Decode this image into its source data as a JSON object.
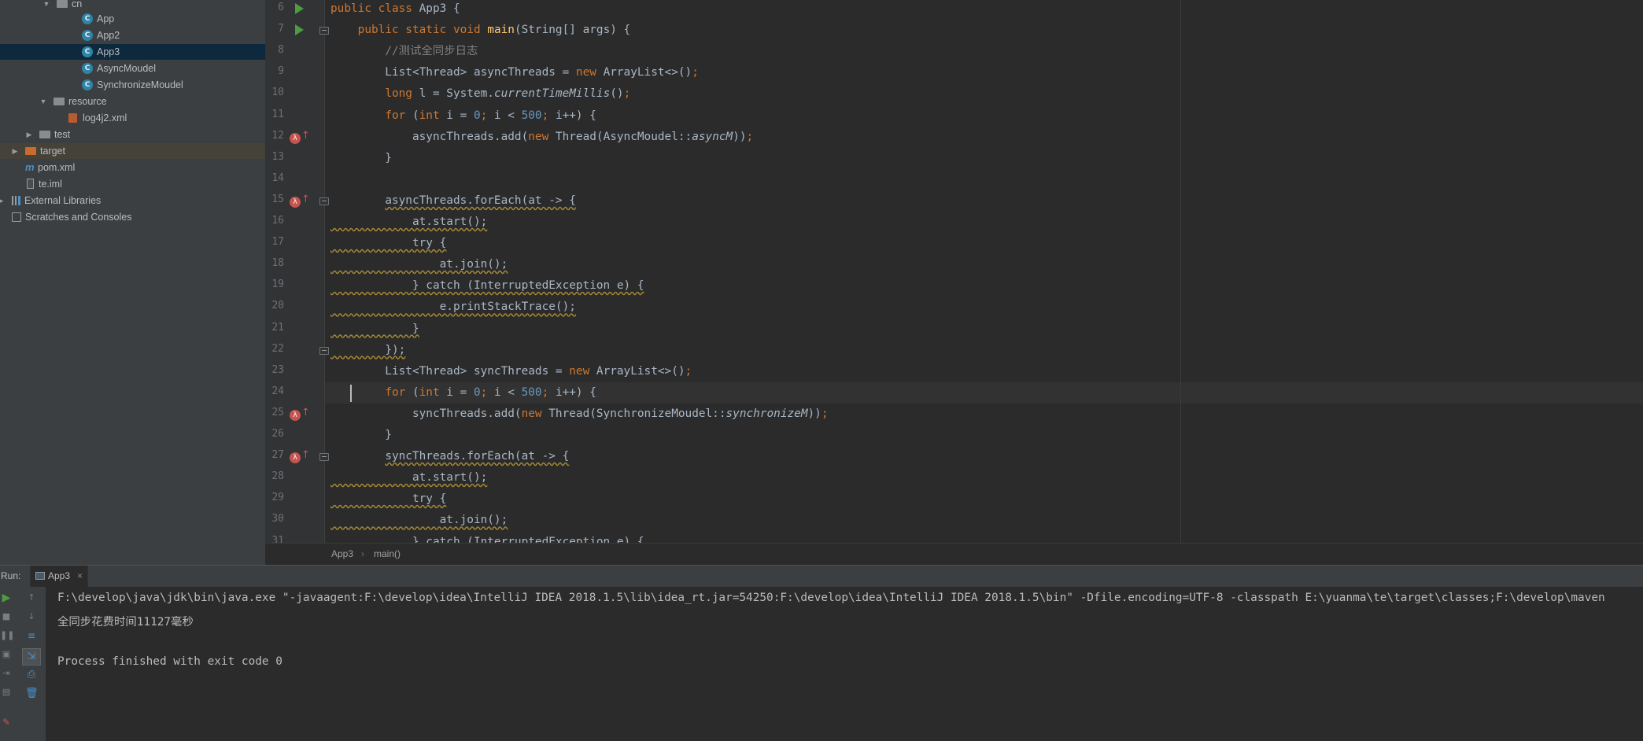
{
  "project_tree": {
    "items": [
      {
        "label": "cn",
        "kind": "package"
      },
      {
        "label": "App",
        "kind": "class"
      },
      {
        "label": "App2",
        "kind": "class"
      },
      {
        "label": "App3",
        "kind": "class",
        "selected": true
      },
      {
        "label": "AsyncMoudel",
        "kind": "class"
      },
      {
        "label": "SynchronizeMoudel",
        "kind": "class"
      },
      {
        "label": "resource",
        "kind": "folder"
      },
      {
        "label": "log4j2.xml",
        "kind": "xml"
      },
      {
        "label": "test",
        "kind": "folder"
      },
      {
        "label": "target",
        "kind": "folder-target"
      },
      {
        "label": "pom.xml",
        "kind": "maven"
      },
      {
        "label": "te.iml",
        "kind": "file"
      },
      {
        "label": "External Libraries",
        "kind": "library"
      },
      {
        "label": "Scratches and Consoles",
        "kind": "scratch"
      }
    ],
    "class_icon_letter": "C"
  },
  "editor": {
    "lines": [
      {
        "n": "6",
        "code": [
          [
            "k",
            "public class "
          ],
          [
            "p",
            "App3 {"
          ]
        ]
      },
      {
        "n": "7",
        "code": [
          [
            "p",
            "    "
          ],
          [
            "k",
            "public static void "
          ],
          [
            "f",
            "main"
          ],
          [
            "p",
            "(String[] args) {"
          ]
        ]
      },
      {
        "n": "8",
        "code": [
          [
            "p",
            "        "
          ],
          [
            "c",
            "//测试全同步日志"
          ]
        ]
      },
      {
        "n": "9",
        "code": [
          [
            "p",
            "        List<Thread> asyncThreads = "
          ],
          [
            "k",
            "new "
          ],
          [
            "p",
            "ArrayList<>()"
          ],
          [
            "k",
            ";"
          ]
        ]
      },
      {
        "n": "10",
        "code": [
          [
            "p",
            "        "
          ],
          [
            "k",
            "long "
          ],
          [
            "p",
            "l = System."
          ],
          [
            "i",
            "currentTimeMillis"
          ],
          [
            "p",
            "()"
          ],
          [
            "k",
            ";"
          ]
        ]
      },
      {
        "n": "11",
        "code": [
          [
            "p",
            "        "
          ],
          [
            "k",
            "for "
          ],
          [
            "p",
            "("
          ],
          [
            "k",
            "int "
          ],
          [
            "p",
            "i = "
          ],
          [
            "n",
            "0"
          ],
          [
            "k",
            "; "
          ],
          [
            "p",
            "i < "
          ],
          [
            "n",
            "500"
          ],
          [
            "k",
            "; "
          ],
          [
            "p",
            "i++) {"
          ]
        ]
      },
      {
        "n": "12",
        "code": [
          [
            "p",
            "            asyncThreads.add("
          ],
          [
            "k",
            "new "
          ],
          [
            "p",
            "Thread(AsyncMoudel::"
          ],
          [
            "i",
            "asyncM"
          ],
          [
            "p",
            "))"
          ],
          [
            "k",
            ";"
          ]
        ]
      },
      {
        "n": "13",
        "code": [
          [
            "p",
            "        }"
          ]
        ]
      },
      {
        "n": "14",
        "code": []
      },
      {
        "n": "15",
        "code": [
          [
            "p",
            "        "
          ],
          [
            "w",
            "asyncThreads.forEach(at -> {"
          ]
        ]
      },
      {
        "n": "16",
        "code": [
          [
            "w",
            "            at.start();"
          ]
        ]
      },
      {
        "n": "17",
        "code": [
          [
            "w",
            "            try {"
          ]
        ]
      },
      {
        "n": "18",
        "code": [
          [
            "w",
            "                at.join();"
          ]
        ]
      },
      {
        "n": "19",
        "code": [
          [
            "w",
            "            } catch (InterruptedException e) {"
          ]
        ]
      },
      {
        "n": "20",
        "code": [
          [
            "w",
            "                e.printStackTrace();"
          ]
        ]
      },
      {
        "n": "21",
        "code": [
          [
            "w",
            "            }"
          ]
        ]
      },
      {
        "n": "22",
        "code": [
          [
            "w",
            "        });"
          ]
        ]
      },
      {
        "n": "23",
        "code": [
          [
            "p",
            "        List<Thread> syncThreads = "
          ],
          [
            "k",
            "new "
          ],
          [
            "p",
            "ArrayList<>()"
          ],
          [
            "k",
            ";"
          ]
        ]
      },
      {
        "n": "24",
        "code": [
          [
            "p",
            "        "
          ],
          [
            "k",
            "for "
          ],
          [
            "p",
            "("
          ],
          [
            "k",
            "int "
          ],
          [
            "p",
            "i = "
          ],
          [
            "n",
            "0"
          ],
          [
            "k",
            "; "
          ],
          [
            "p",
            "i < "
          ],
          [
            "n",
            "500"
          ],
          [
            "k",
            "; "
          ],
          [
            "p",
            "i++) {"
          ]
        ]
      },
      {
        "n": "25",
        "code": [
          [
            "p",
            "            syncThreads.add("
          ],
          [
            "k",
            "new "
          ],
          [
            "p",
            "Thread(SynchronizeMoudel::"
          ],
          [
            "i",
            "synchronizeM"
          ],
          [
            "p",
            "))"
          ],
          [
            "k",
            ";"
          ]
        ]
      },
      {
        "n": "26",
        "code": [
          [
            "p",
            "        }"
          ]
        ]
      },
      {
        "n": "27",
        "code": [
          [
            "p",
            "        "
          ],
          [
            "w",
            "syncThreads.forEach(at -> {"
          ]
        ]
      },
      {
        "n": "28",
        "code": [
          [
            "w",
            "            at.start();"
          ]
        ]
      },
      {
        "n": "29",
        "code": [
          [
            "w",
            "            try {"
          ]
        ]
      },
      {
        "n": "30",
        "code": [
          [
            "w",
            "                at.join();"
          ]
        ]
      },
      {
        "n": "31",
        "code": [
          [
            "w",
            "            } catch (InterruptedException e) {"
          ]
        ]
      }
    ],
    "run_gutter_lines": [
      "6",
      "7"
    ],
    "lambda_gutter_lines": [
      "12",
      "15",
      "25",
      "27"
    ],
    "fold_lines": [
      "7",
      "15",
      "22",
      "27"
    ],
    "caret_line": "24",
    "lambda_icon": "λ",
    "colors": {
      "keyword": "#cc7832",
      "number": "#6897bb",
      "comment": "#808080",
      "method": "#ffc66d",
      "text": "#a9b7c6",
      "warning": "#a68a36"
    }
  },
  "breadcrumb": {
    "class_name": "App3",
    "separator": "›",
    "method": "main()"
  },
  "run_panel": {
    "label": "Run:",
    "tab_label": "App3",
    "tab_close": "×",
    "console_lines": [
      "F:\\develop\\java\\jdk\\bin\\java.exe \"-javaagent:F:\\develop\\idea\\IntelliJ IDEA 2018.1.5\\lib\\idea_rt.jar=54250:F:\\develop\\idea\\IntelliJ IDEA 2018.1.5\\bin\" -Dfile.encoding=UTF-8 -classpath E:\\yuanma\\te\\target\\classes;F:\\develop\\maven",
      "全同步花费时间11127毫秒",
      "",
      "Process finished with exit code 0"
    ]
  }
}
